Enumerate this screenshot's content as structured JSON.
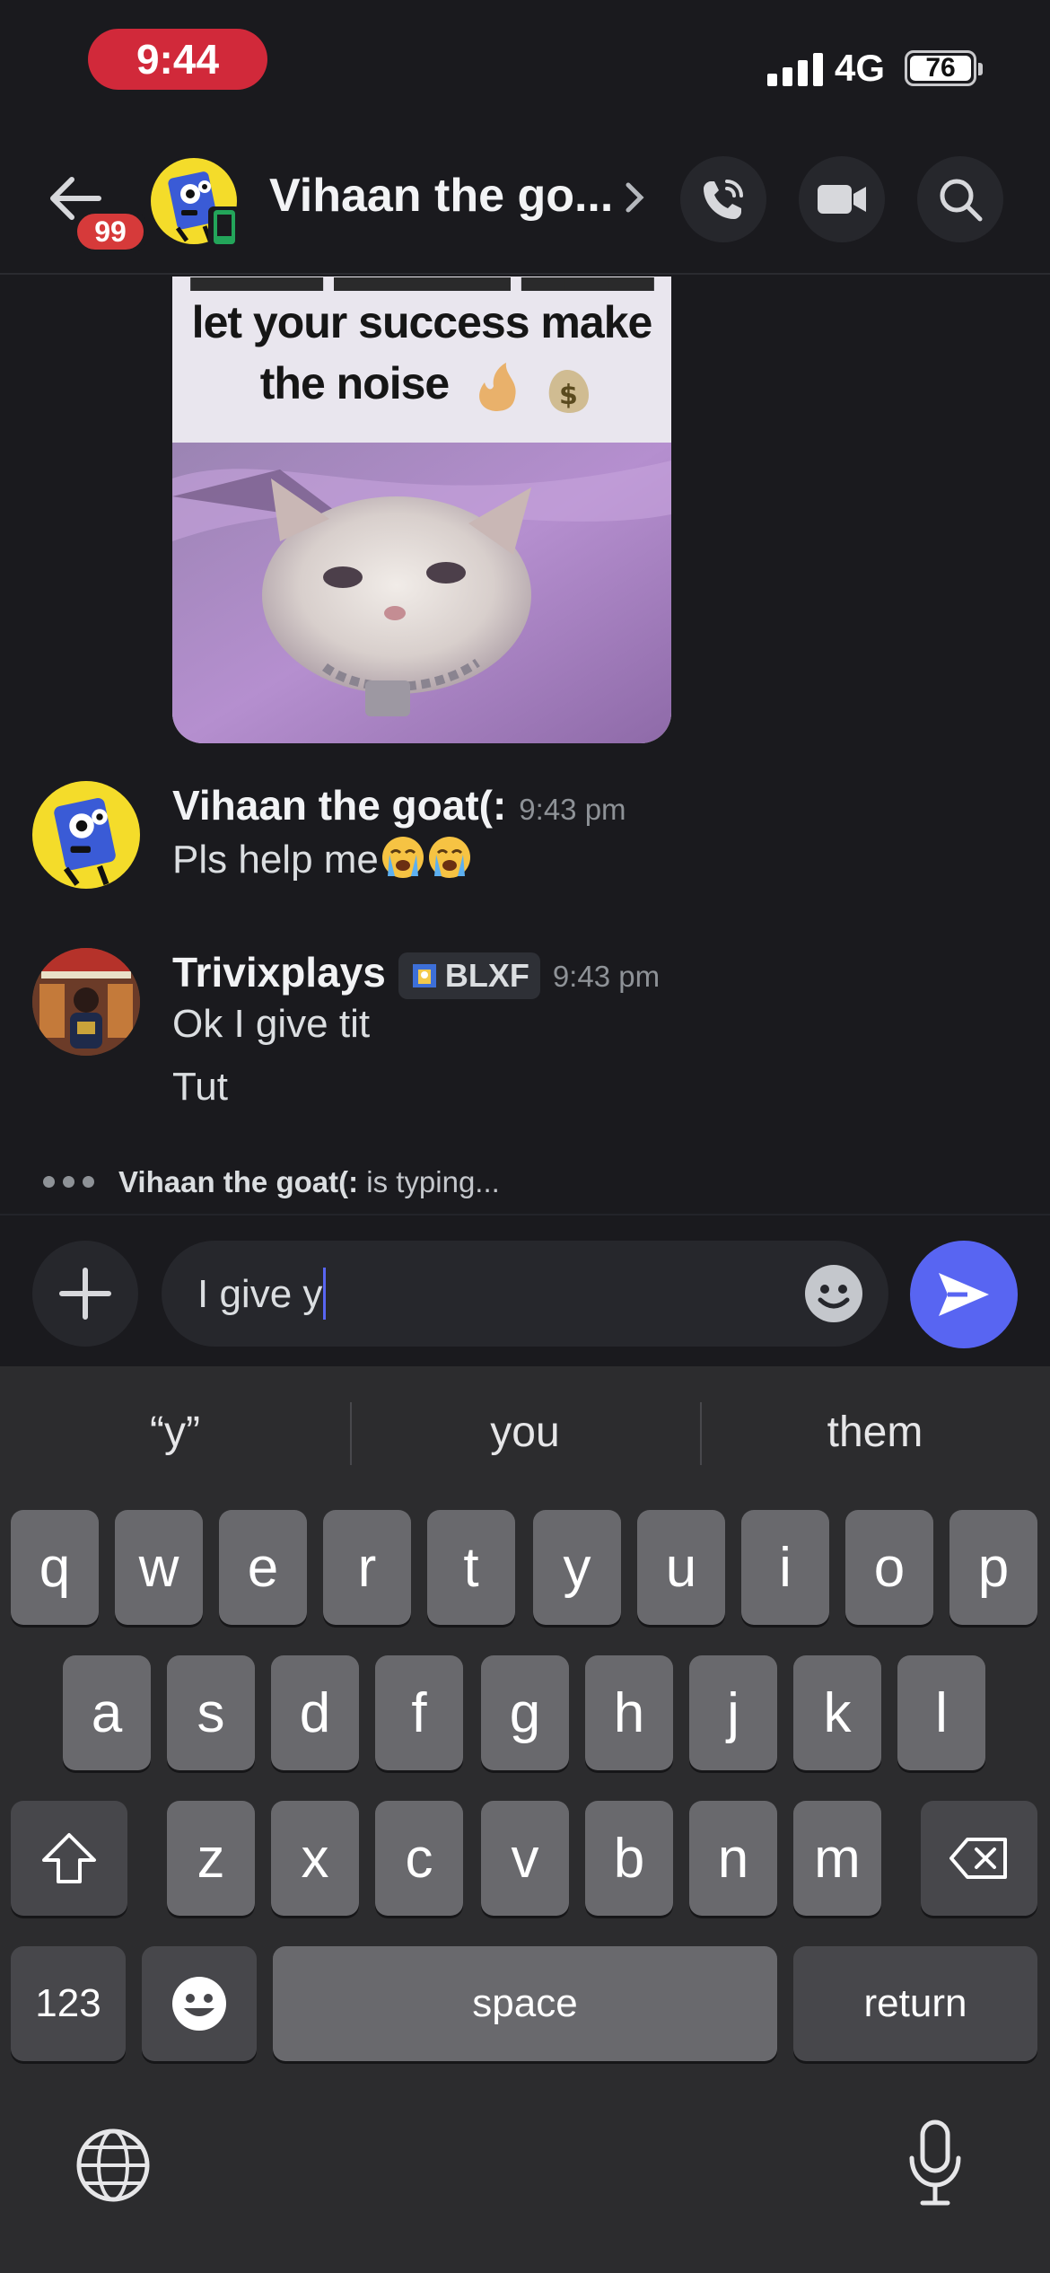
{
  "status_bar": {
    "time": "9:44",
    "network": "4G",
    "battery": "76"
  },
  "header": {
    "unread_count": "99",
    "channel_name": "Vihaan the go...",
    "buttons": [
      "voice-call",
      "video-call",
      "search"
    ]
  },
  "meme": {
    "caption_line1": "let your success make",
    "caption_line2": "the noise"
  },
  "messages": [
    {
      "author": "Vihaan the goat(:",
      "time": "9:43 pm",
      "lines": [
        "Pls help me"
      ]
    },
    {
      "author": "Trivixplays",
      "tag": "BLXF",
      "time": "9:43 pm",
      "lines": [
        "Ok I give tit",
        "Tut"
      ]
    }
  ],
  "typing": {
    "user": "Vihaan the goat(:",
    "suffix": " is typing..."
  },
  "composer": {
    "value": "I give y"
  },
  "keyboard": {
    "suggestions": [
      "“y”",
      "you",
      "them"
    ],
    "row1": [
      "q",
      "w",
      "e",
      "r",
      "t",
      "y",
      "u",
      "i",
      "o",
      "p"
    ],
    "row2": [
      "a",
      "s",
      "d",
      "f",
      "g",
      "h",
      "j",
      "k",
      "l"
    ],
    "row3": [
      "z",
      "x",
      "c",
      "v",
      "b",
      "n",
      "m"
    ],
    "numbers_label": "123",
    "space_label": "space",
    "return_label": "return"
  },
  "colors": {
    "accent": "#5865f2",
    "badge": "#d63a3a",
    "time_pill": "#d1293a",
    "background": "#1a1a1e"
  }
}
